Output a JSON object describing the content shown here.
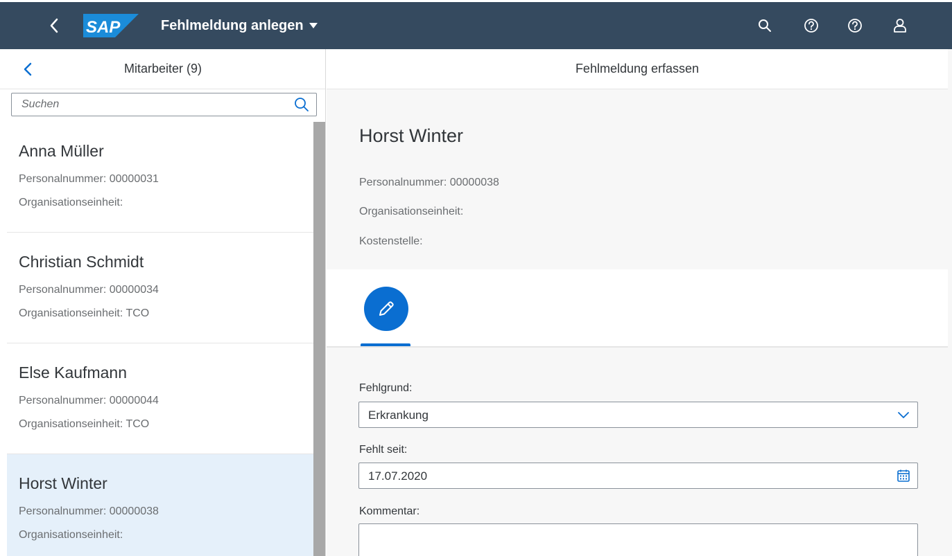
{
  "shell": {
    "title": "Fehlmeldung anlegen",
    "logo_text": "SAP",
    "icons": [
      "back-icon",
      "search-icon",
      "help-icon",
      "help-icon",
      "user-icon"
    ],
    "colors": {
      "bar": "#354a5f",
      "logo": "#1b8cd9"
    }
  },
  "master": {
    "title": "Mitarbeiter (9)",
    "search_placeholder": "Suchen",
    "items": [
      {
        "name": "Anna Müller",
        "personalnummer": "Personalnummer: 00000031",
        "orgeinheit": "Organisationseinheit:"
      },
      {
        "name": "Christian Schmidt",
        "personalnummer": "Personalnummer: 00000034",
        "orgeinheit": "Organisationseinheit: TCO"
      },
      {
        "name": "Else Kaufmann",
        "personalnummer": "Personalnummer: 00000044",
        "orgeinheit": "Organisationseinheit: TCO"
      },
      {
        "name": "Horst Winter",
        "personalnummer": "Personalnummer: 00000038",
        "orgeinheit": "Organisationseinheit:"
      }
    ],
    "selected_index": 3,
    "selection_color": "#e5f0fa"
  },
  "detail": {
    "title": "Fehlmeldung erfassen",
    "employee": {
      "name": "Horst Winter",
      "personalnummer": "Personalnummer: 00000038",
      "orgeinheit": "Organisationseinheit:",
      "kostenstelle": "Kostenstelle:"
    },
    "tab_icon": "edit-icon",
    "accent": "#0a6ed1",
    "form": {
      "fehlgrund_label": "Fehlgrund:",
      "fehlgrund_value": "Erkrankung",
      "fehlt_seit_label": "Fehlt seit:",
      "fehlt_seit_value": "17.07.2020",
      "kommentar_label": "Kommentar:",
      "kommentar_value": ""
    }
  }
}
